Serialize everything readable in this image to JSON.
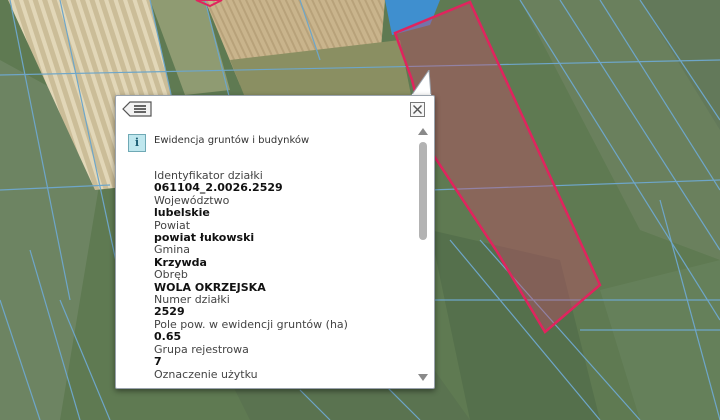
{
  "map": {
    "background_color": "#5f7a52",
    "parcel_line_color": "#6ea6c9",
    "selected_parcel_color": "#e0245e"
  },
  "popup": {
    "back_icon": "list-back-icon",
    "close_icon": "close-icon",
    "section_title": "Ewidencja gruntów i budynków",
    "fields": [
      {
        "label": "Identyfikator działki",
        "value": "061104_2.0026.2529"
      },
      {
        "label": "Województwo",
        "value": "lubelskie"
      },
      {
        "label": "Powiat",
        "value": "powiat łukowski"
      },
      {
        "label": "Gmina",
        "value": "Krzywda"
      },
      {
        "label": "Obręb",
        "value": "WOLA OKRZEJSKA"
      },
      {
        "label": "Numer działki",
        "value": "2529"
      },
      {
        "label": "Pole pow. w ewidencji gruntów (ha)",
        "value": "0.65"
      },
      {
        "label": "Grupa rejestrowa",
        "value": "7"
      },
      {
        "label": "Oznaczenie użytku",
        "value": ""
      }
    ]
  }
}
